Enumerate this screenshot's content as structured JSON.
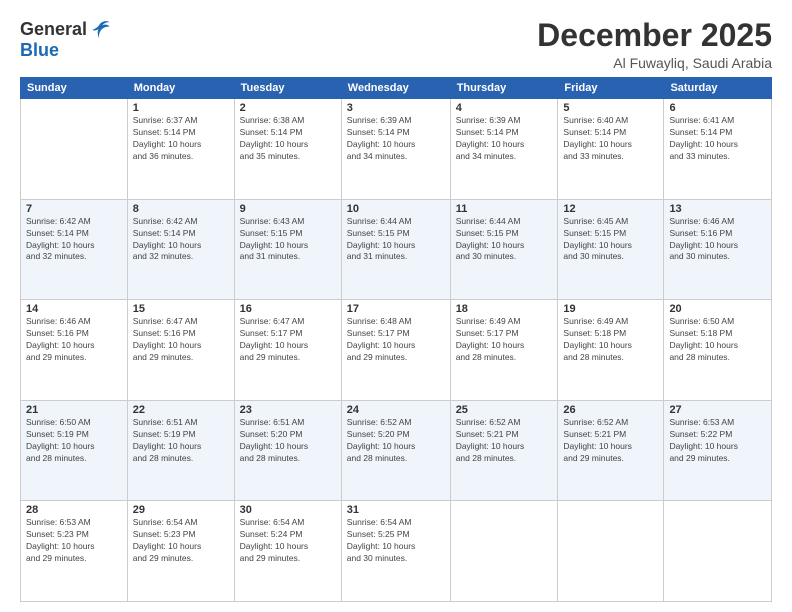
{
  "logo": {
    "general": "General",
    "blue": "Blue"
  },
  "header": {
    "month": "December 2025",
    "location": "Al Fuwayliq, Saudi Arabia"
  },
  "days_of_week": [
    "Sunday",
    "Monday",
    "Tuesday",
    "Wednesday",
    "Thursday",
    "Friday",
    "Saturday"
  ],
  "weeks": [
    [
      {
        "day": "",
        "info": ""
      },
      {
        "day": "1",
        "info": "Sunrise: 6:37 AM\nSunset: 5:14 PM\nDaylight: 10 hours\nand 36 minutes."
      },
      {
        "day": "2",
        "info": "Sunrise: 6:38 AM\nSunset: 5:14 PM\nDaylight: 10 hours\nand 35 minutes."
      },
      {
        "day": "3",
        "info": "Sunrise: 6:39 AM\nSunset: 5:14 PM\nDaylight: 10 hours\nand 34 minutes."
      },
      {
        "day": "4",
        "info": "Sunrise: 6:39 AM\nSunset: 5:14 PM\nDaylight: 10 hours\nand 34 minutes."
      },
      {
        "day": "5",
        "info": "Sunrise: 6:40 AM\nSunset: 5:14 PM\nDaylight: 10 hours\nand 33 minutes."
      },
      {
        "day": "6",
        "info": "Sunrise: 6:41 AM\nSunset: 5:14 PM\nDaylight: 10 hours\nand 33 minutes."
      }
    ],
    [
      {
        "day": "7",
        "info": "Sunrise: 6:42 AM\nSunset: 5:14 PM\nDaylight: 10 hours\nand 32 minutes."
      },
      {
        "day": "8",
        "info": "Sunrise: 6:42 AM\nSunset: 5:14 PM\nDaylight: 10 hours\nand 32 minutes."
      },
      {
        "day": "9",
        "info": "Sunrise: 6:43 AM\nSunset: 5:15 PM\nDaylight: 10 hours\nand 31 minutes."
      },
      {
        "day": "10",
        "info": "Sunrise: 6:44 AM\nSunset: 5:15 PM\nDaylight: 10 hours\nand 31 minutes."
      },
      {
        "day": "11",
        "info": "Sunrise: 6:44 AM\nSunset: 5:15 PM\nDaylight: 10 hours\nand 30 minutes."
      },
      {
        "day": "12",
        "info": "Sunrise: 6:45 AM\nSunset: 5:15 PM\nDaylight: 10 hours\nand 30 minutes."
      },
      {
        "day": "13",
        "info": "Sunrise: 6:46 AM\nSunset: 5:16 PM\nDaylight: 10 hours\nand 30 minutes."
      }
    ],
    [
      {
        "day": "14",
        "info": "Sunrise: 6:46 AM\nSunset: 5:16 PM\nDaylight: 10 hours\nand 29 minutes."
      },
      {
        "day": "15",
        "info": "Sunrise: 6:47 AM\nSunset: 5:16 PM\nDaylight: 10 hours\nand 29 minutes."
      },
      {
        "day": "16",
        "info": "Sunrise: 6:47 AM\nSunset: 5:17 PM\nDaylight: 10 hours\nand 29 minutes."
      },
      {
        "day": "17",
        "info": "Sunrise: 6:48 AM\nSunset: 5:17 PM\nDaylight: 10 hours\nand 29 minutes."
      },
      {
        "day": "18",
        "info": "Sunrise: 6:49 AM\nSunset: 5:17 PM\nDaylight: 10 hours\nand 28 minutes."
      },
      {
        "day": "19",
        "info": "Sunrise: 6:49 AM\nSunset: 5:18 PM\nDaylight: 10 hours\nand 28 minutes."
      },
      {
        "day": "20",
        "info": "Sunrise: 6:50 AM\nSunset: 5:18 PM\nDaylight: 10 hours\nand 28 minutes."
      }
    ],
    [
      {
        "day": "21",
        "info": "Sunrise: 6:50 AM\nSunset: 5:19 PM\nDaylight: 10 hours\nand 28 minutes."
      },
      {
        "day": "22",
        "info": "Sunrise: 6:51 AM\nSunset: 5:19 PM\nDaylight: 10 hours\nand 28 minutes."
      },
      {
        "day": "23",
        "info": "Sunrise: 6:51 AM\nSunset: 5:20 PM\nDaylight: 10 hours\nand 28 minutes."
      },
      {
        "day": "24",
        "info": "Sunrise: 6:52 AM\nSunset: 5:20 PM\nDaylight: 10 hours\nand 28 minutes."
      },
      {
        "day": "25",
        "info": "Sunrise: 6:52 AM\nSunset: 5:21 PM\nDaylight: 10 hours\nand 28 minutes."
      },
      {
        "day": "26",
        "info": "Sunrise: 6:52 AM\nSunset: 5:21 PM\nDaylight: 10 hours\nand 29 minutes."
      },
      {
        "day": "27",
        "info": "Sunrise: 6:53 AM\nSunset: 5:22 PM\nDaylight: 10 hours\nand 29 minutes."
      }
    ],
    [
      {
        "day": "28",
        "info": "Sunrise: 6:53 AM\nSunset: 5:23 PM\nDaylight: 10 hours\nand 29 minutes."
      },
      {
        "day": "29",
        "info": "Sunrise: 6:54 AM\nSunset: 5:23 PM\nDaylight: 10 hours\nand 29 minutes."
      },
      {
        "day": "30",
        "info": "Sunrise: 6:54 AM\nSunset: 5:24 PM\nDaylight: 10 hours\nand 29 minutes."
      },
      {
        "day": "31",
        "info": "Sunrise: 6:54 AM\nSunset: 5:25 PM\nDaylight: 10 hours\nand 30 minutes."
      },
      {
        "day": "",
        "info": ""
      },
      {
        "day": "",
        "info": ""
      },
      {
        "day": "",
        "info": ""
      }
    ]
  ]
}
